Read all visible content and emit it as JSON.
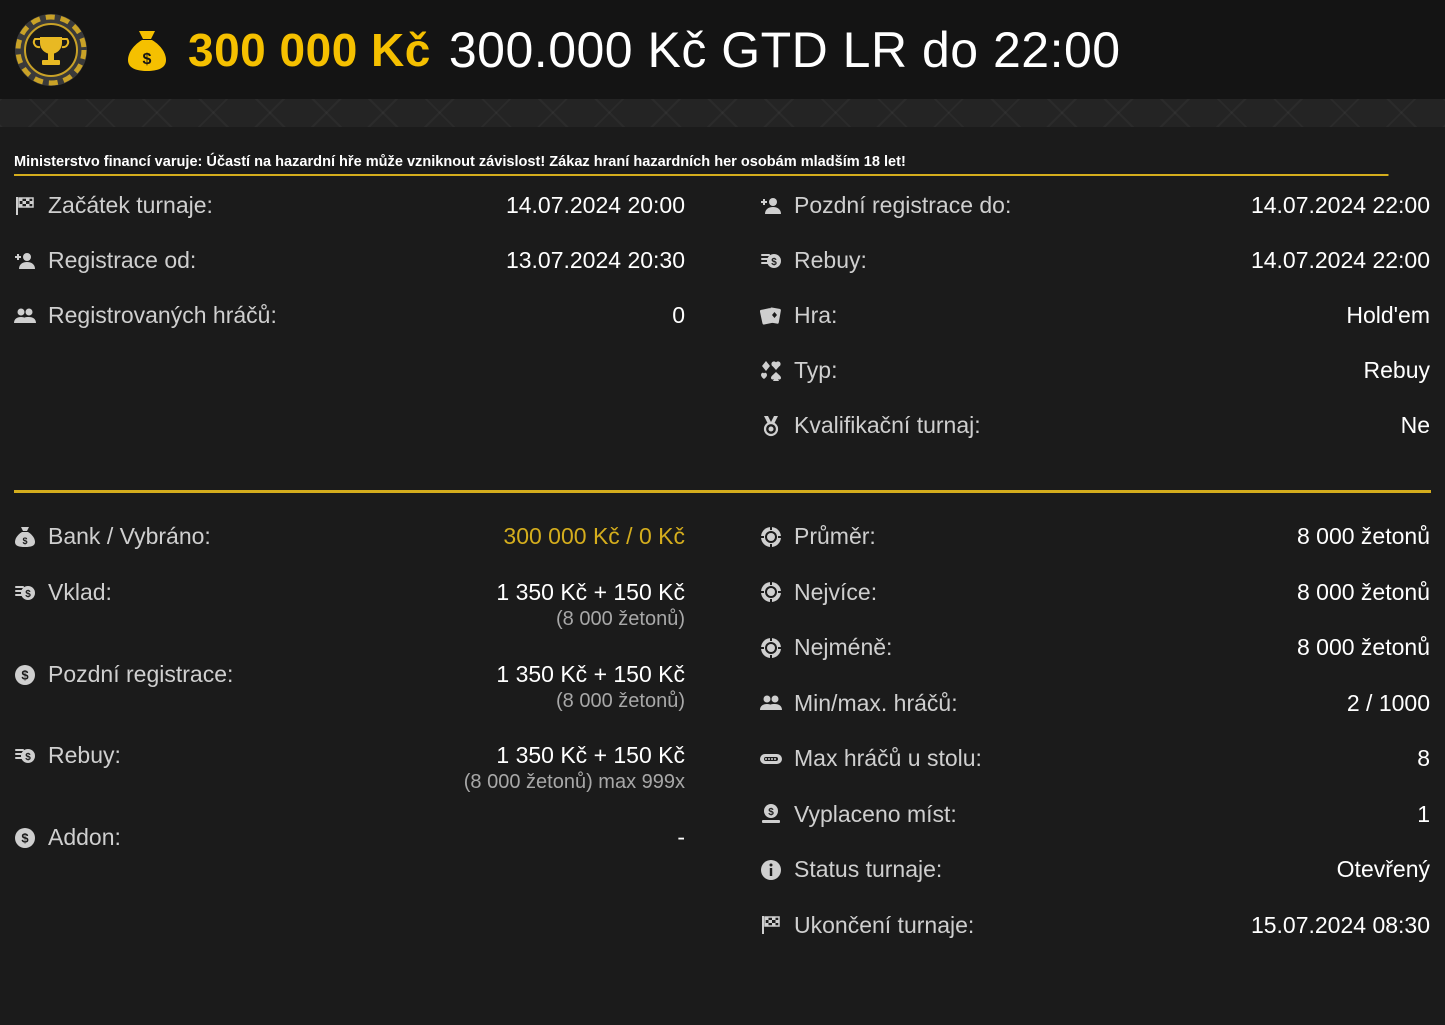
{
  "header": {
    "prize": "300 000 Kč",
    "title": "300.000 Kč GTD LR do 22:00",
    "brand_color": "#f5c000",
    "logo_icon": "trophy-chip-icon",
    "prize_icon": "money-bag-icon"
  },
  "warning": "Ministerstvo financí varuje: Účastí na hazardní hře může vzniknout závislost! Zákaz hraní hazardních her osobám mladším 18 let!",
  "info": {
    "left": [
      {
        "icon": "flag-icon",
        "label": "Začátek turnaje:",
        "value": "14.07.2024 20:00"
      },
      {
        "icon": "user-plus-icon",
        "label": "Registrace od:",
        "value": "13.07.2024 20:30"
      },
      {
        "icon": "users-icon",
        "label": "Registrovaných hráčů:",
        "value": "0"
      }
    ],
    "right": [
      {
        "icon": "user-plus-icon",
        "label": "Pozdní registrace do:",
        "value": "14.07.2024 22:00"
      },
      {
        "icon": "coins-icon",
        "label": "Rebuy:",
        "value": "14.07.2024 22:00"
      },
      {
        "icon": "cards-icon",
        "label": "Hra:",
        "value": "Hold'em"
      },
      {
        "icon": "suits-icon",
        "label": "Typ:",
        "value": "Rebuy"
      },
      {
        "icon": "medal-icon",
        "label": "Kvalifikační turnaj:",
        "value": "Ne"
      }
    ]
  },
  "finance": {
    "left": [
      {
        "icon": "money-bag-icon",
        "label": "Bank / Vybráno:",
        "value": "300 000 Kč / 0 Kč",
        "sub": ""
      },
      {
        "icon": "coins-icon",
        "label": "Vklad:",
        "value": "1 350 Kč + 150 Kč",
        "sub": "(8 000 žetonů)"
      },
      {
        "icon": "dollar-coin-icon",
        "label": "Pozdní registrace:",
        "value": "1 350 Kč + 150 Kč",
        "sub": "(8 000 žetonů)"
      },
      {
        "icon": "coins-icon",
        "label": "Rebuy:",
        "value": "1 350 Kč + 150 Kč",
        "sub": "(8 000 žetonů) max 999x"
      },
      {
        "icon": "dollar-coin-icon",
        "label": "Addon:",
        "value": "-",
        "sub": ""
      }
    ],
    "right": [
      {
        "icon": "chip-icon",
        "label": "Průměr:",
        "value": "8 000 žetonů"
      },
      {
        "icon": "chip-icon",
        "label": "Nejvíce:",
        "value": "8 000 žetonů"
      },
      {
        "icon": "chip-icon",
        "label": "Nejméně:",
        "value": "8 000 žetonů"
      },
      {
        "icon": "users-icon",
        "label": "Min/max. hráčů:",
        "value": "2 / 1000"
      },
      {
        "icon": "table-icon",
        "label": "Max hráčů u stolu:",
        "value": "8"
      },
      {
        "icon": "payout-icon",
        "label": "Vyplaceno míst:",
        "value": "1"
      },
      {
        "icon": "info-icon",
        "label": "Status turnaje:",
        "value": "Otevřený"
      },
      {
        "icon": "flag-icon",
        "label": "Ukončení turnaje:",
        "value": "15.07.2024 08:30"
      }
    ]
  }
}
